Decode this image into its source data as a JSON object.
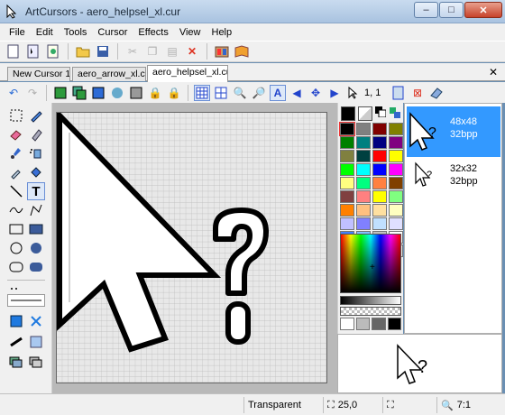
{
  "window": {
    "title": "ArtCursors - aero_helpsel_xl.cur",
    "minimize": "–",
    "maximize": "□",
    "close": "✕"
  },
  "menu": [
    "File",
    "Edit",
    "Tools",
    "Cursor",
    "Effects",
    "View",
    "Help"
  ],
  "tabs": [
    "New Cursor 1",
    "aero_arrow_xl.cur",
    "aero_helpsel_xl.cur"
  ],
  "tab_close": "✕",
  "toolbar2": {
    "hotspot_readout": "1, 1"
  },
  "sizes": [
    {
      "label": "48x48",
      "bpp": "32bpp",
      "selected": true
    },
    {
      "label": "32x32",
      "bpp": "32bpp",
      "selected": false
    }
  ],
  "palette": {
    "colors": [
      "#000000",
      "#808080",
      "#800000",
      "#808000",
      "#008000",
      "#008080",
      "#000080",
      "#800080",
      "#808040",
      "#004040",
      "#ff0000",
      "#ffff00",
      "#00ff00",
      "#00ffff",
      "#0000ff",
      "#ff00ff",
      "#ffff80",
      "#00ff80",
      "#ff8040",
      "#804000",
      "#804040",
      "#ff8080",
      "#ffff00",
      "#80ff80",
      "#ff8000",
      "#ffc080",
      "#ffe0a0",
      "#ffffc0",
      "#c0c0ff",
      "#8080ff",
      "#c0e0ff",
      "#e0e0ff",
      "#4080ff",
      "#80c0ff",
      "#c0c0c0",
      "#ffffff",
      "#a0a0ff",
      "#c0ffff",
      "#e0ffff",
      "#f0f0f0"
    ],
    "foreground": "#000000",
    "background": "#ffffff"
  },
  "status": {
    "color_name": "Transparent",
    "position": "25,0",
    "zoom": "7:1"
  },
  "colors": {
    "accent": "#3399ff",
    "selection": "#3a8ee6"
  }
}
